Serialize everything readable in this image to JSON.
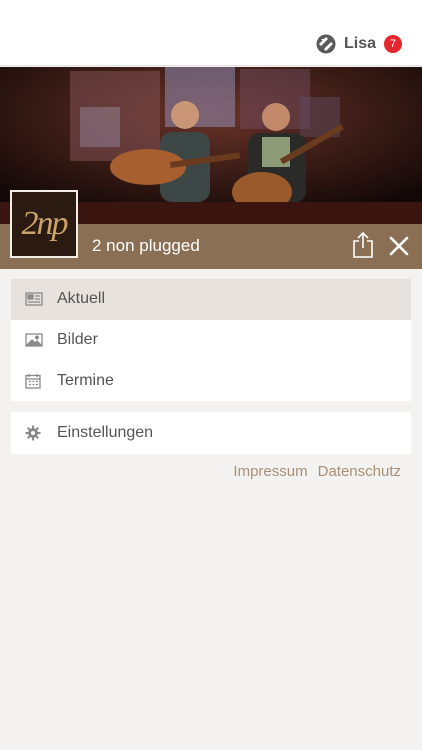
{
  "header": {
    "user_name": "Lisa",
    "notification_count": "7"
  },
  "band": {
    "name": "2 non plugged",
    "logo_text": "2np"
  },
  "menu": {
    "items": [
      {
        "label": "Aktuell",
        "icon": "newspaper-icon",
        "active": true
      },
      {
        "label": "Bilder",
        "icon": "image-icon",
        "active": false
      },
      {
        "label": "Termine",
        "icon": "calendar-icon",
        "active": false
      }
    ],
    "settings_label": "Einstellungen"
  },
  "footer": {
    "impressum": "Impressum",
    "datenschutz": "Datenschutz"
  },
  "colors": {
    "brand_bar": "#8a6f55",
    "active_row": "#e7e2dd",
    "badge": "#e5262c",
    "link": "#a89078"
  }
}
